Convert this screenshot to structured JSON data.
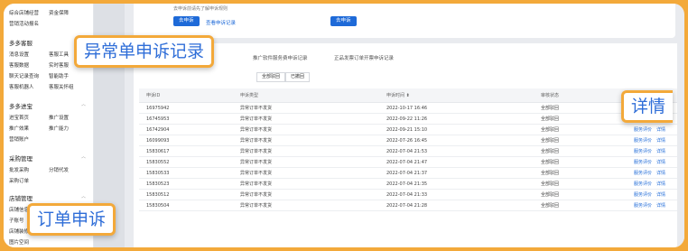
{
  "sidebar": {
    "top_rows": [
      {
        "col1": "综合店铺经营",
        "col2": "资金保障"
      },
      {
        "col1": "营销活动报名",
        "col2": ""
      }
    ],
    "groups": [
      {
        "title": "多多客服",
        "rows": [
          {
            "col1": "消息设置",
            "col2": "客服工具"
          },
          {
            "col1": "客服数据",
            "col2": "实时客服"
          },
          {
            "col1": "聊天记录查询",
            "col2": "智能助手"
          },
          {
            "col1": "客服机器人",
            "col2": "客服关怀组"
          }
        ]
      },
      {
        "title": "多多进宝",
        "rows": [
          {
            "col1": "进宝首页",
            "col2": "推广设置"
          },
          {
            "col1": "推广效果",
            "col2": "推广能力"
          },
          {
            "col1": "营销账户",
            "col2": ""
          }
        ]
      },
      {
        "title": "采购管理",
        "rows": [
          {
            "col1": "批发采购",
            "col2": "分销代发"
          },
          {
            "col1": "采购订单",
            "col2": ""
          }
        ]
      },
      {
        "title": "店铺管理",
        "rows": [
          {
            "col1": "店铺信息",
            "col2": ""
          },
          {
            "col1": "子账号",
            "col2": ""
          },
          {
            "col1": "店铺装修",
            "col2": ""
          },
          {
            "col1": "图片空间",
            "col2": ""
          }
        ]
      }
    ]
  },
  "top_card": {
    "note": "去申诉前请先了解申诉规则",
    "appeal_button_1": "去申诉",
    "appeal_record_link": "查看申诉记录",
    "appeal_button_2": "去申诉"
  },
  "tabs": [
    "推广软件服务费申诉记录",
    "正品发票订单开票申诉记录"
  ],
  "filters": [
    "全部驳回",
    "已撤回"
  ],
  "table": {
    "headers": {
      "id": "申诉ID",
      "type": "申诉类型",
      "time": "申诉时间",
      "status": "审核状态",
      "action": "操作"
    },
    "rows": [
      {
        "id": "16975942",
        "type": "异常订单不发货",
        "time": "2022-10-17 16:46",
        "status": "全部驳回"
      },
      {
        "id": "16745953",
        "type": "异常订单不发货",
        "time": "2022-09-22 11:26",
        "status": "全部驳回"
      },
      {
        "id": "16742904",
        "type": "异常订单不发货",
        "time": "2022-09-21 15:10",
        "status": "全部驳回"
      },
      {
        "id": "16099093",
        "type": "异常订单不发货",
        "time": "2022-07-26 16:45",
        "status": "全部驳回"
      },
      {
        "id": "15830617",
        "type": "异常订单不发货",
        "time": "2022-07-04 21:53",
        "status": "全部驳回"
      },
      {
        "id": "15830552",
        "type": "异常订单不发货",
        "time": "2022-07-04 21:47",
        "status": "全部驳回"
      },
      {
        "id": "15830533",
        "type": "异常订单不发货",
        "time": "2022-07-04 21:37",
        "status": "全部驳回"
      },
      {
        "id": "15830523",
        "type": "异常订单不发货",
        "time": "2022-07-04 21:35",
        "status": "全部驳回"
      },
      {
        "id": "15830512",
        "type": "异常订单不发货",
        "time": "2022-07-04 21:33",
        "status": "全部驳回"
      },
      {
        "id": "15830504",
        "type": "异常订单不发货",
        "time": "2022-07-04 21:28",
        "status": "全部驳回"
      }
    ],
    "action_labels": {
      "evaluate": "服务评价",
      "detail": "详情"
    }
  },
  "callouts": {
    "abnormal_record": "异常单申诉记录",
    "detail": "详情",
    "order_appeal": "订单申诉"
  },
  "colors": {
    "accent": "#1e6ad8",
    "callout_border": "#f3a93a",
    "callout_text": "#2f6ed8"
  }
}
